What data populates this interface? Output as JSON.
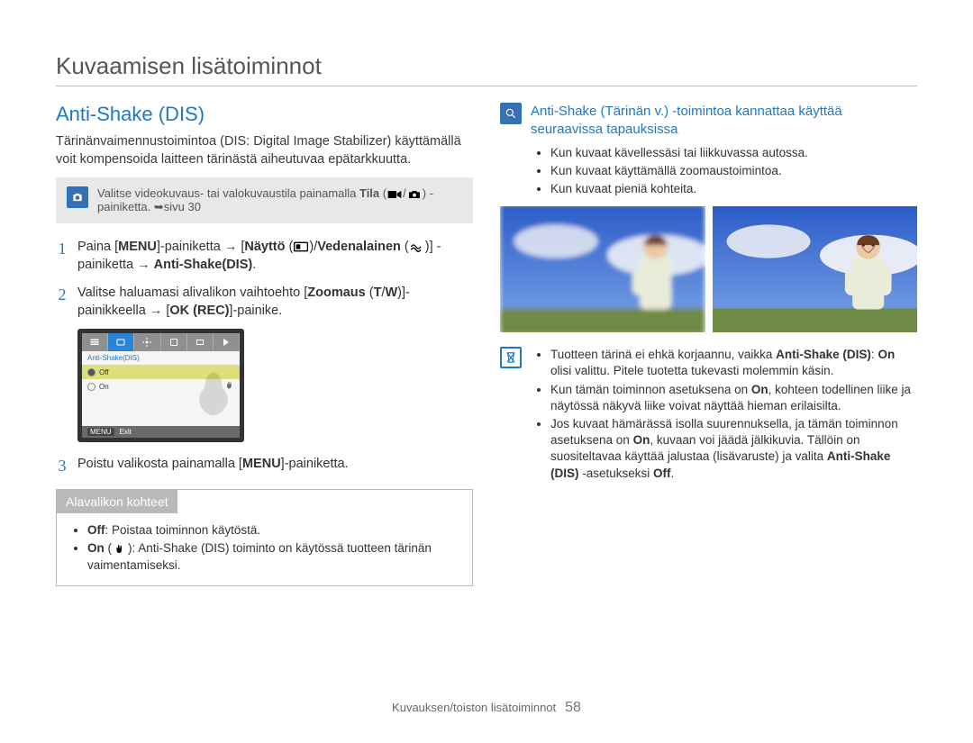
{
  "page_title": "Kuvaamisen lisätoiminnot",
  "section_heading": "Anti-Shake (DIS)",
  "intro_paragraph": "Tärinänvaimennustoimintoa (DIS: Digital Image Stabilizer) käyttämällä voit kompensoida laitteen tärinästä aiheutuvaa epätarkkuutta.",
  "gray_note": {
    "prefix": "Valitse videokuvaus- tai valokuvaustila painamalla ",
    "bold": "Tila",
    "suffix": " -painiketta. ➥sivu 30"
  },
  "steps": [
    {
      "num": "1",
      "segments": [
        {
          "t": "Paina ["
        },
        {
          "t": "MENU",
          "b": true
        },
        {
          "t": "]-painiketta → ["
        },
        {
          "t": "Näyttö",
          "b": true
        },
        {
          "t": " ("
        },
        {
          "icon": "display"
        },
        {
          "t": ")"
        },
        {
          "t": "/"
        },
        {
          "t": "Vedenalainen",
          "b": true
        },
        {
          "t": " ("
        },
        {
          "icon": "underwater"
        },
        {
          "t": ")"
        },
        {
          "t": "] -painiketta → "
        },
        {
          "t": "Anti-Shake(DIS)",
          "b": true
        },
        {
          "t": "."
        }
      ]
    },
    {
      "num": "2",
      "segments": [
        {
          "t": "Valitse haluamasi alivalikon vaihtoehto ["
        },
        {
          "t": "Zoomaus",
          "b": true
        },
        {
          "t": " ("
        },
        {
          "t": "T",
          "b": true
        },
        {
          "t": "/"
        },
        {
          "t": "W",
          "b": true
        },
        {
          "t": ")]- painikkeella → ["
        },
        {
          "t": "OK (REC)",
          "b": true
        },
        {
          "t": "]-painike."
        }
      ]
    },
    {
      "num": "3",
      "segments": [
        {
          "t": "Poistu valikosta painamalla ["
        },
        {
          "t": "MENU",
          "b": true
        },
        {
          "t": "]-painiketta."
        }
      ]
    }
  ],
  "menu_thumb": {
    "head": "Anti-Shake(DIS)",
    "rows": [
      {
        "label": "Off",
        "selected": true
      },
      {
        "label": "On",
        "selected": false
      }
    ],
    "foot_btn": "MENU",
    "foot_lbl": "Exit"
  },
  "sub_box": {
    "heading": "Alavalikon kohteet",
    "items": [
      {
        "segments": [
          {
            "t": "Off",
            "b": true
          },
          {
            "t": ": Poistaa toiminnon käytöstä."
          }
        ]
      },
      {
        "segments": [
          {
            "t": "On",
            "b": true
          },
          {
            "t": " ("
          },
          {
            "icon": "hand"
          },
          {
            "t": "): Anti-Shake (DIS) toiminto on käytössä tuotteen tärinän vaimentamiseksi."
          }
        ]
      }
    ]
  },
  "right_info": {
    "heading": "Anti-Shake (Tärinän v.) -toimintoa kannattaa käyttää seuraavissa tapauksissa",
    "items": [
      "Kun kuvaat kävellessäsi tai liikkuvassa autossa.",
      "Kun kuvaat käyttämällä zoomaustoimintoa.",
      "Kun kuvaat pieniä kohteita."
    ]
  },
  "right_notes": [
    {
      "segments": [
        {
          "t": "Tuotteen tärinä ei ehkä korjaannu, vaikka "
        },
        {
          "t": "Anti-Shake (DIS)",
          "b": true
        },
        {
          "t": ": "
        },
        {
          "t": "On",
          "b": true
        },
        {
          "t": " olisi valittu. Pitele tuotetta tukevasti molemmin käsin."
        }
      ]
    },
    {
      "segments": [
        {
          "t": "Kun tämän toiminnon asetuksena on "
        },
        {
          "t": "On",
          "b": true
        },
        {
          "t": ", kohteen todellinen liike ja näytössä näkyvä liike voivat näyttää hieman erilaisilta."
        }
      ]
    },
    {
      "segments": [
        {
          "t": "Jos kuvaat hämärässä isolla suurennuksella, ja tämän toiminnon asetuksena on "
        },
        {
          "t": "On",
          "b": true
        },
        {
          "t": ", kuvaan voi jäädä jälkikuvia. Tällöin on suositeltavaa käyttää jalustaa (lisävaruste) ja valita "
        },
        {
          "t": "Anti-Shake (DIS)",
          "b": true
        },
        {
          "t": " -asetukseksi "
        },
        {
          "t": "Off",
          "b": true
        },
        {
          "t": "."
        }
      ]
    }
  ],
  "footer": {
    "label": "Kuvauksen/toiston lisätoiminnot",
    "page": "58"
  }
}
